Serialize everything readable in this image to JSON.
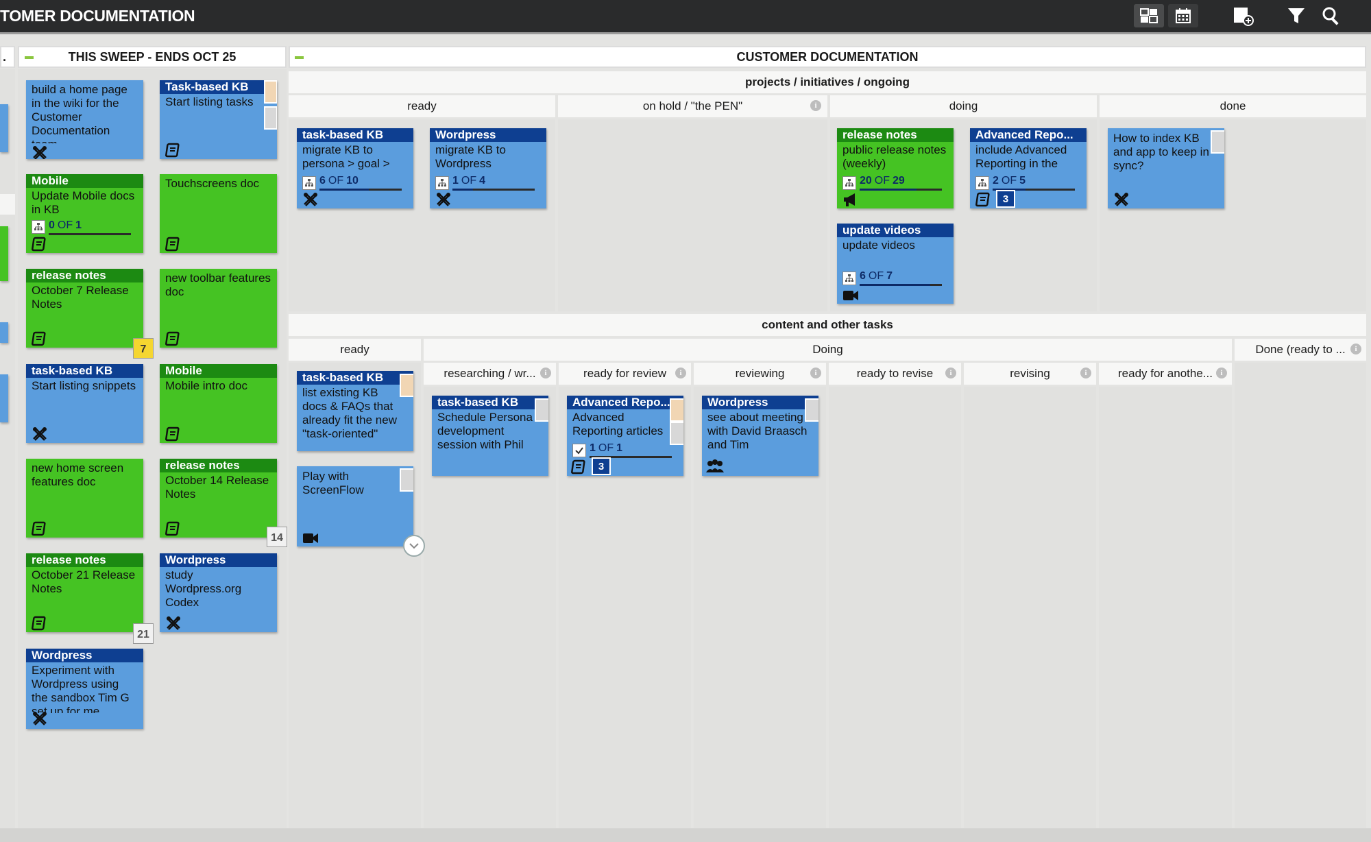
{
  "app_title": "TOMER DOCUMENTATION",
  "toolbar": {
    "icons": [
      "board-view-icon",
      "calendar-icon",
      "add-card-icon",
      "filter-icon",
      "search-icon"
    ]
  },
  "sweep_lane": {
    "title": "THIS SWEEP - ENDS OCT 25",
    "cards": [
      {
        "color": "blue",
        "title": "",
        "text": "build a home page in the wiki for the Customer Documentation team",
        "icon": "tools-icon"
      },
      {
        "color": "blue",
        "title": "Task-based KB",
        "text": "Start listing tasks",
        "icon": "book-icon"
      },
      {
        "color": "green",
        "title": "Mobile",
        "text": "Update Mobile docs in KB",
        "done": "0",
        "total": "1",
        "of": "OF",
        "icon": "book-icon"
      },
      {
        "color": "green",
        "title": "",
        "text": "Touchscreens doc",
        "icon": "book-icon"
      },
      {
        "color": "green",
        "title": "release notes",
        "text": "October 7 Release Notes",
        "icon": "book-icon",
        "cal": "7"
      },
      {
        "color": "green",
        "title": "",
        "text": "new toolbar features doc",
        "icon": "book-icon"
      },
      {
        "color": "blue",
        "title": "task-based KB",
        "text": "Start listing snippets",
        "icon": "tools-icon"
      },
      {
        "color": "green",
        "title": "Mobile",
        "text": "Mobile intro doc",
        "icon": "book-icon"
      },
      {
        "color": "green",
        "title": "",
        "text": "new home screen features doc",
        "icon": "book-icon"
      },
      {
        "color": "green",
        "title": "release notes",
        "text": "October 14 Release Notes",
        "icon": "book-icon",
        "cal": "14"
      },
      {
        "color": "green",
        "title": "release notes",
        "text": "October 21 Release Notes",
        "icon": "book-icon",
        "cal": "21"
      },
      {
        "color": "blue",
        "title": "Wordpress",
        "text": "study Wordpress.org Codex",
        "icon": "tools-icon"
      },
      {
        "color": "blue",
        "title": "Wordpress",
        "text": "Experiment with Wordpress using the sandbox Tim G set up for me",
        "icon": "tools-icon"
      }
    ]
  },
  "main_lane": {
    "title": "CUSTOMER DOCUMENTATION",
    "section1": {
      "title": "projects / initiatives / ongoing",
      "columns": [
        "ready",
        "on hold / \"the PEN\"",
        "doing",
        "done"
      ],
      "cards": [
        {
          "title": "task-based KB",
          "text": "migrate KB to persona > goal >",
          "done": "6",
          "total": "10",
          "of": "OF",
          "icon": "tools-icon"
        },
        {
          "title": "Wordpress",
          "text": "migrate KB to Wordpress",
          "done": "1",
          "total": "4",
          "of": "OF",
          "icon": "tools-icon"
        },
        {
          "title": "release notes",
          "text": "public release notes (weekly)",
          "done": "20",
          "total": "29",
          "of": "OF",
          "icon": "megaphone-icon"
        },
        {
          "title": "Advanced Repo...",
          "text": "include Advanced Reporting in the",
          "done": "2",
          "total": "5",
          "of": "OF",
          "icon": "book-icon",
          "badge": "3"
        },
        {
          "title": "update videos",
          "text": "update videos",
          "done": "6",
          "total": "7",
          "of": "OF",
          "icon": "video-icon"
        },
        {
          "title": "",
          "text": "How to index KB and app to keep in sync?",
          "icon": "tools-icon"
        }
      ]
    },
    "section2": {
      "title": "content and other tasks",
      "ready": "ready",
      "doing": "Doing",
      "done_col": "Done (ready to ...",
      "subcolumns": [
        "researching / wr...",
        "ready for review",
        "reviewing",
        "ready to revise",
        "revising",
        "ready for anothe..."
      ],
      "cards": [
        {
          "title": "task-based KB",
          "text": "list existing KB docs & FAQs that already fit the new \"task-oriented\""
        },
        {
          "title": "",
          "text": "Play with ScreenFlow",
          "icon": "video-icon"
        },
        {
          "title": "task-based KB",
          "text": "Schedule Persona development session with Phil"
        },
        {
          "title": "Advanced Repo...",
          "text": "Advanced Reporting articles",
          "done": "1",
          "total": "1",
          "of": "OF",
          "icon": "book-icon",
          "badge": "3"
        },
        {
          "title": "Wordpress",
          "text": "see about meeting with David Braasch and Tim",
          "icon": "people-icon"
        }
      ]
    }
  }
}
